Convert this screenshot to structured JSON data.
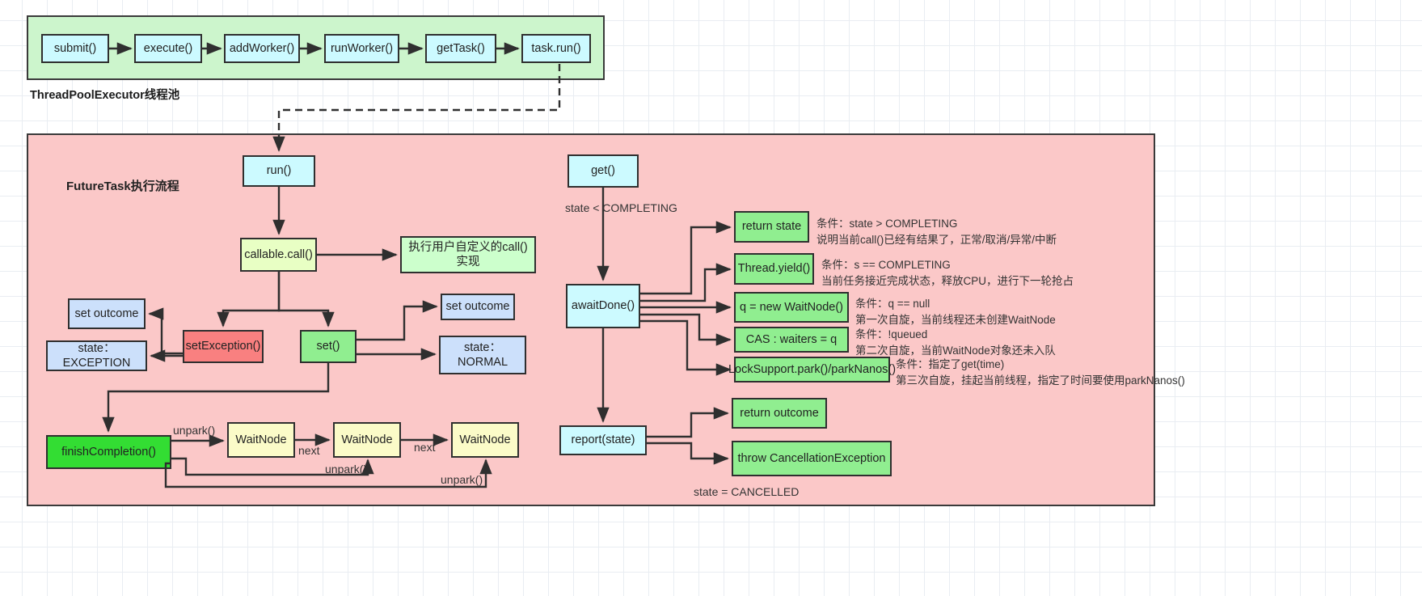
{
  "diagram": {
    "title_top_panel": "ThreadPoolExecutor线程池",
    "title_main_panel": "FutureTask执行流程"
  },
  "thread_pool_chain": [
    {
      "label": "submit()"
    },
    {
      "label": "execute()"
    },
    {
      "label": "addWorker()"
    },
    {
      "label": "runWorker()"
    },
    {
      "label": "getTask()"
    },
    {
      "label": "task.run()"
    }
  ],
  "futuretask": {
    "run": "run()",
    "callable_call": "callable.call()",
    "user_call_impl": "执行用户自定义的call()实现",
    "set_outcome_exception": "set outcome",
    "set_outcome_normal": "set outcome",
    "state_exception": "state：EXCEPTION",
    "state_normal": "state：\nNORMAL",
    "state_normal_line1": "state：",
    "state_normal_line2": "NORMAL",
    "set_exception": "setException()",
    "set": "set()",
    "finish_completion": "finishCompletion()",
    "waitnodes": [
      "WaitNode",
      "WaitNode",
      "WaitNode"
    ],
    "edge_next_1": "next",
    "edge_next_2": "next",
    "edge_unpark_1": "unpark()",
    "edge_unpark_2": "unpark()",
    "edge_unpark_3": "unpark()"
  },
  "get_flow": {
    "get": "get()",
    "edge_state_lt_completing": "state < COMPLETING",
    "await_done": "awaitDone()",
    "report_state": "report(state)",
    "edge_state_cancelled": "state = CANCELLED",
    "branches": [
      {
        "box": "return state",
        "cond_line1": "条件：state > COMPLETING",
        "cond_line2": "说明当前call()已经有结果了，正常/取消/异常/中断"
      },
      {
        "box": "Thread.yield()",
        "cond_line1": "条件：s == COMPLETING",
        "cond_line2": "当前任务接近完成状态，释放CPU，进行下一轮抢占"
      },
      {
        "box": "q = new WaitNode()",
        "cond_line1": "条件：q == null",
        "cond_line2": "第一次自旋，当前线程还未创建WaitNode"
      },
      {
        "box": "CAS : waiters = q",
        "cond_line1": "条件：!queued",
        "cond_line2": "第二次自旋，当前WaitNode对象还未入队"
      },
      {
        "box": "LockSupport.park()/parkNanos()",
        "cond_line1": "条件：指定了get(time)",
        "cond_line2": "第三次自旋，挂起当前线程，指定了时间要使用parkNanos()"
      }
    ],
    "results": [
      {
        "box": "return outcome"
      },
      {
        "box": "throw CancellationException"
      }
    ]
  },
  "colors": {
    "panel_green": "#ccf5cc",
    "panel_pink": "#fbc8c8",
    "node_cyan": "#ccfaff",
    "node_green": "#90ee90",
    "node_light_green": "#ccffcc",
    "node_lime": "#e8ffc4",
    "node_blue": "#cce0fb",
    "node_red": "#f98080",
    "node_bright_green": "#33dd33",
    "node_yellow": "#fbfbc8",
    "stroke": "#2f2f2f"
  }
}
